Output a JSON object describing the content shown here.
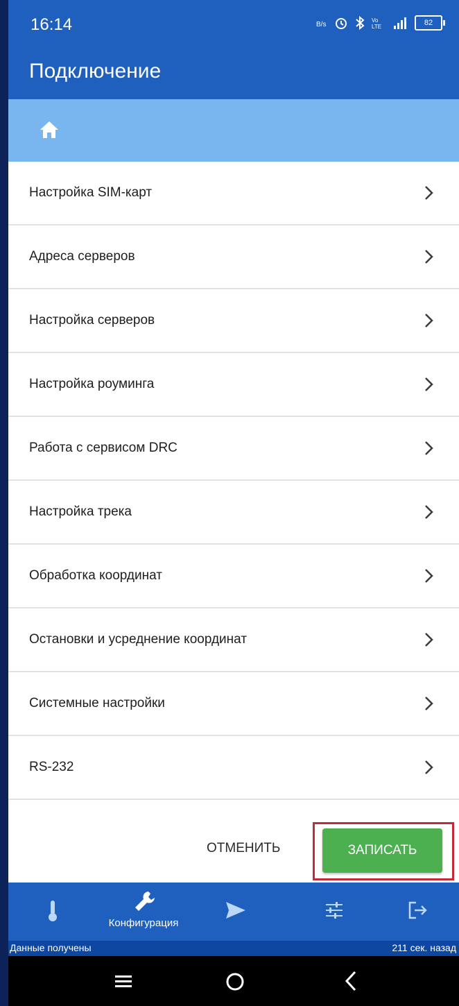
{
  "status_bar": {
    "time": "16:14",
    "battery": "82"
  },
  "app_bar": {
    "title": "Подключение"
  },
  "menu": {
    "items": [
      {
        "label": "Настройка SIM-карт"
      },
      {
        "label": "Адреса серверов"
      },
      {
        "label": "Настройка серверов"
      },
      {
        "label": "Настройка роуминга"
      },
      {
        "label": "Работа с сервисом DRC"
      },
      {
        "label": "Настройка трека"
      },
      {
        "label": "Обработка координат"
      },
      {
        "label": "Остановки и усреднение координат"
      },
      {
        "label": "Системные настройки"
      },
      {
        "label": "RS-232"
      }
    ]
  },
  "actions": {
    "cancel_label": "ОТМЕНИТЬ",
    "save_label": "ЗАПИСАТЬ"
  },
  "bottom_nav": {
    "items": [
      {
        "icon": "thermometer-icon"
      },
      {
        "icon": "wrench-icon",
        "label": "Конфигурация",
        "active": true
      },
      {
        "icon": "send-icon"
      },
      {
        "icon": "sliders-icon"
      },
      {
        "icon": "exit-icon"
      }
    ]
  },
  "status_line": {
    "left": "Данные получены",
    "right": "211 сек. назад"
  },
  "colors": {
    "primary": "#1f5fbd",
    "breadcrumb": "#79b6f0",
    "save_button": "#4caf50",
    "highlight": "#c52a3a"
  }
}
